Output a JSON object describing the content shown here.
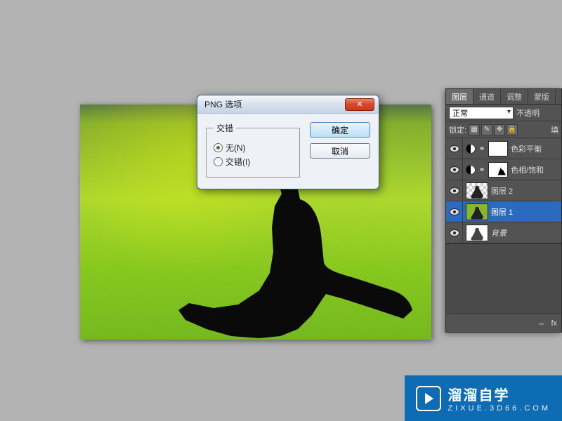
{
  "dialog": {
    "title": "PNG 选项",
    "fieldset_legend": "交错",
    "radio_none": "无(N)",
    "radio_interlaced": "交错(I)",
    "ok": "确定",
    "cancel": "取消",
    "close_glyph": "✕"
  },
  "panel": {
    "tabs": [
      "图层",
      "通道",
      "调整",
      "蒙版"
    ],
    "blend_mode": "正常",
    "opacity_label": "不透明",
    "lock_label": "锁定:",
    "fill_label": "填",
    "footer_link": "⇔",
    "footer_fx": "fx"
  },
  "layers": [
    {
      "name": "色彩平衡",
      "type": "adjustment",
      "mask": "white"
    },
    {
      "name": "色相/饱和",
      "type": "adjustment",
      "mask": "hue"
    },
    {
      "name": "图层 2",
      "type": "bitmap-transparent"
    },
    {
      "name": "图层 1",
      "type": "bitmap",
      "selected": true
    },
    {
      "name": "背景",
      "type": "background",
      "italic": true
    }
  ],
  "watermark": {
    "main": "溜溜自学",
    "sub": "ZIXUE.3D66.COM"
  }
}
